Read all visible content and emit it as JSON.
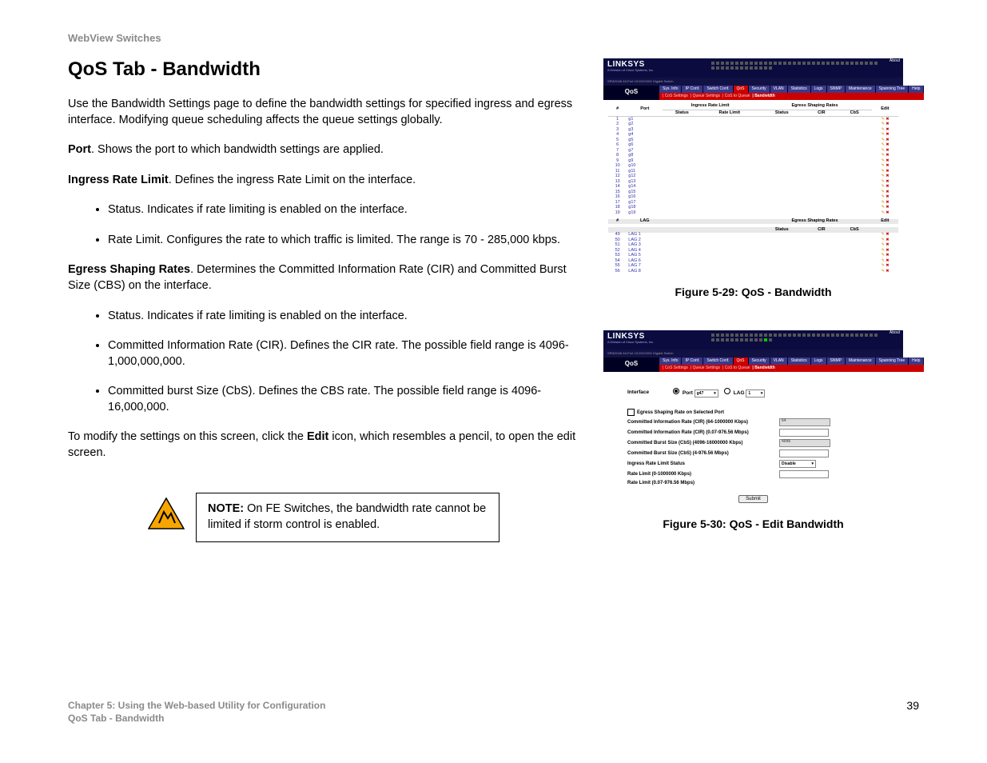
{
  "header": "WebView Switches",
  "title": "QoS Tab - Bandwidth",
  "intro": "Use the Bandwidth Settings page to define the bandwidth settings for specified ingress and egress interface. Modifying queue scheduling affects the queue settings globally.",
  "port_label": "Port",
  "port_text": ". Shows the port to which bandwidth settings are applied.",
  "ingress_label": "Ingress Rate Limit",
  "ingress_text": ". Defines the ingress Rate Limit on the interface.",
  "ingress_bullets": [
    "Status. Indicates if rate limiting is enabled on the interface.",
    "Rate Limit. Configures the rate to which traffic is limited. The range is 70 - 285,000 kbps."
  ],
  "egress_label": "Egress Shaping Rates",
  "egress_text": ". Determines the Committed Information Rate (CIR) and Committed Burst Size (CBS) on the interface.",
  "egress_bullets": [
    "Status. Indicates if rate limiting is enabled on the interface.",
    "Committed Information Rate (CIR). Defines the CIR rate. The possible field range is 4096-1,000,000,000.",
    "Committed burst Size (CbS). Defines the CBS rate. The possible field range is 4096-16,000,000."
  ],
  "modify_pre": "To modify the settings on this screen, click the ",
  "modify_bold": "Edit",
  "modify_post": " icon, which resembles a pencil, to open the edit screen.",
  "note_label": "NOTE:",
  "note_text": "  On FE Switches, the bandwidth rate cannot be limited if storm control is enabled.",
  "footer_chapter": "Chapter 5: Using the Web-based Utility for Configuration",
  "footer_section": "QoS Tab - Bandwidth",
  "page_number": "39",
  "fig1": {
    "caption": "Figure 5-29: QoS - Bandwidth",
    "logo": "LINKSYS",
    "logo_sub": "A Division of Cisco Systems, Inc.",
    "about": "About",
    "model": "SRW2048 48-Port 10/100/1000 Gigabit Switch",
    "qos": "QoS",
    "tabs": [
      "Sys. Info",
      "IP Conf.",
      "Switch Conf.",
      "QoS",
      "Security",
      "VLAN",
      "Statistics",
      "Logs",
      "SNMP",
      "Maintenance",
      "Spanning Tree",
      "Help"
    ],
    "subtabs": [
      "CoS Settings",
      "Queue Settings",
      "CoS to Queue",
      "Bandwidth"
    ],
    "th": {
      "num": "#",
      "port": "Port",
      "irl": "Ingress Rate Limit",
      "status": "Status",
      "rate": "Rate Limit",
      "esr": "Egress Shaping Rates",
      "cir": "CIR",
      "cbs": "CbS",
      "edit": "Edit",
      "lag": "LAG"
    },
    "ports": [
      {
        "n": "1",
        "p": "g1"
      },
      {
        "n": "2",
        "p": "g2"
      },
      {
        "n": "3",
        "p": "g3"
      },
      {
        "n": "4",
        "p": "g4"
      },
      {
        "n": "5",
        "p": "g5"
      },
      {
        "n": "6",
        "p": "g6"
      },
      {
        "n": "7",
        "p": "g7"
      },
      {
        "n": "8",
        "p": "g8"
      },
      {
        "n": "9",
        "p": "g9"
      },
      {
        "n": "10",
        "p": "g10"
      },
      {
        "n": "11",
        "p": "g11"
      },
      {
        "n": "12",
        "p": "g12"
      },
      {
        "n": "13",
        "p": "g13"
      },
      {
        "n": "14",
        "p": "g14"
      },
      {
        "n": "15",
        "p": "g15"
      },
      {
        "n": "16",
        "p": "g16"
      },
      {
        "n": "17",
        "p": "g17"
      },
      {
        "n": "18",
        "p": "g18"
      },
      {
        "n": "19",
        "p": "g19"
      }
    ],
    "lags": [
      {
        "n": "49",
        "p": "LAG 1"
      },
      {
        "n": "50",
        "p": "LAG 2"
      },
      {
        "n": "51",
        "p": "LAG 3"
      },
      {
        "n": "52",
        "p": "LAG 4"
      },
      {
        "n": "53",
        "p": "LAG 5"
      },
      {
        "n": "54",
        "p": "LAG 6"
      },
      {
        "n": "55",
        "p": "LAG 7"
      },
      {
        "n": "56",
        "p": "LAG 8"
      }
    ]
  },
  "fig2": {
    "caption": "Figure 5-30: QoS - Edit Bandwidth",
    "interface_label": "Interface",
    "port_radio": "Port",
    "port_val": "g47",
    "lag_radio": "LAG",
    "lag_val": "1",
    "rows": [
      {
        "lab": "Egress Shaping Rate on Selected Port",
        "type": "check"
      },
      {
        "lab": "Committed Information Rate (CIR) (64-1000000 Kbps)",
        "type": "in_dis",
        "val": "64"
      },
      {
        "lab": "Committed Information Rate (CIR) (0.07-976.56 Mbps)",
        "type": "in"
      },
      {
        "lab": "Committed Burst Size (CbS) (4096-16000000 Kbps)",
        "type": "in_dis",
        "val": "4096"
      },
      {
        "lab": "Committed Burst Size (CbS) (4-976.56 Mbps)",
        "type": "in"
      },
      {
        "lab": "Ingress Rate Limit Status",
        "type": "sel",
        "val": "Disable"
      },
      {
        "lab": "Rate Limit  (0-1000000 Kbps)",
        "type": "in"
      },
      {
        "lab": "Rate Limit  (0.07-976.56 Mbps)",
        "type": "none"
      }
    ],
    "submit": "Submit"
  }
}
